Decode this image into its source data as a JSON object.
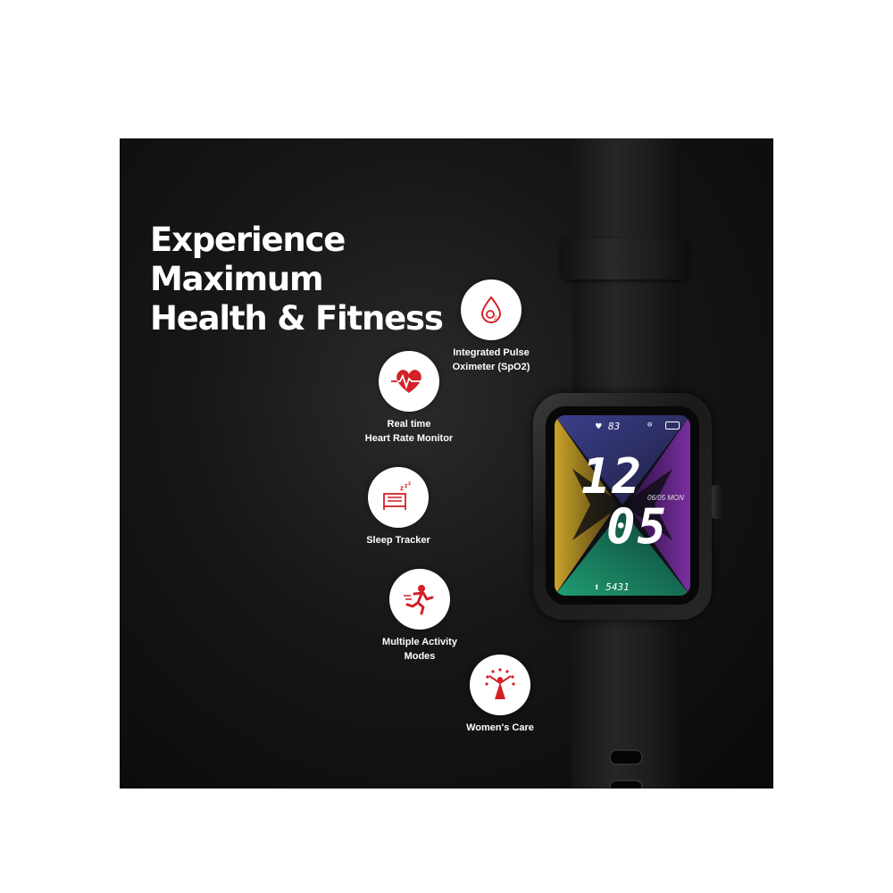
{
  "headline": [
    "Experience",
    "Maximum",
    "Health & Fitness"
  ],
  "features": [
    {
      "icon": "blood-drop-oxygen-icon",
      "label_lines": [
        "Integrated Pulse",
        "Oximeter (SpO2)"
      ]
    },
    {
      "icon": "heart-rate-icon",
      "label_lines": [
        "Real time",
        "Heart Rate Monitor"
      ]
    },
    {
      "icon": "sleep-bed-icon",
      "label_lines": [
        "Sleep Tracker"
      ]
    },
    {
      "icon": "running-person-icon",
      "label_lines": [
        "Multiple Activity",
        "Modes"
      ]
    },
    {
      "icon": "womens-care-icon",
      "label_lines": [
        "Women's Care"
      ]
    }
  ],
  "watch": {
    "heart_rate": "83",
    "hour": "12",
    "minute": "05",
    "date": "06/05 MON",
    "steps": "5431"
  },
  "colors": {
    "background": "#111111",
    "accent": "#d42027",
    "text": "#ffffff"
  }
}
